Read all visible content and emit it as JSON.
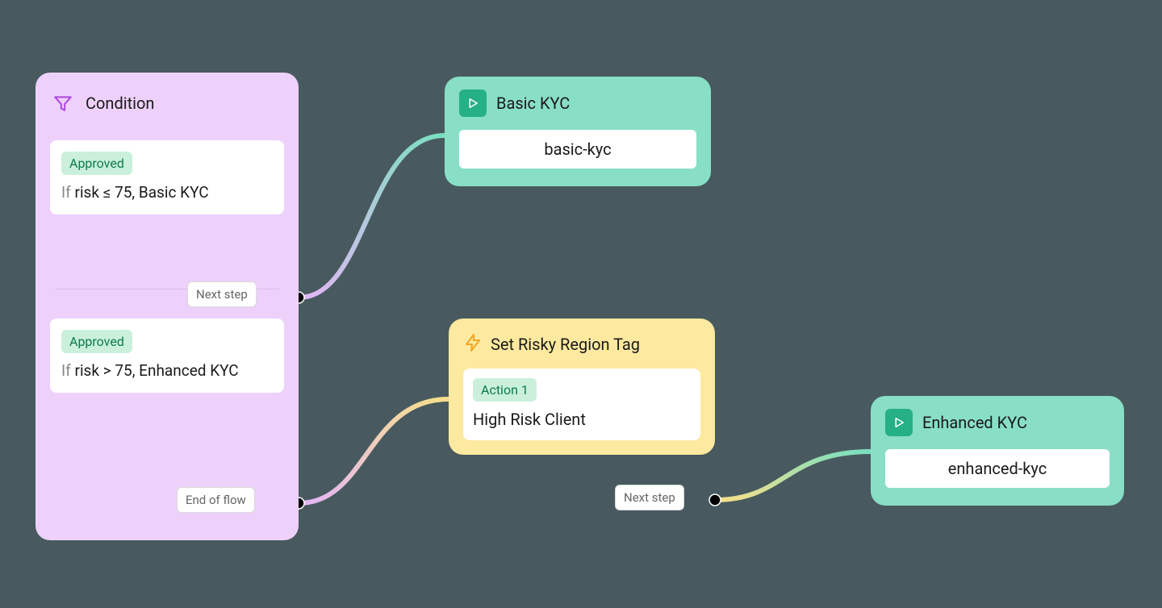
{
  "condition": {
    "title": "Condition",
    "rules": [
      {
        "status": "Approved",
        "ifLabel": "If",
        "text": "risk ≤ 75, Basic KYC",
        "portLabel": "Next step"
      },
      {
        "status": "Approved",
        "ifLabel": "If",
        "text": "risk > 75, Enhanced KYC",
        "portLabel": "End of flow"
      }
    ]
  },
  "basicKyc": {
    "title": "Basic KYC",
    "value": "basic-kyc"
  },
  "setRisky": {
    "title": "Set Risky Region Tag",
    "actionLabel": "Action 1",
    "actionText": "High Risk Client",
    "portLabel": "Next step"
  },
  "enhancedKyc": {
    "title": "Enhanced KYC",
    "value": "enhanced-kyc"
  }
}
